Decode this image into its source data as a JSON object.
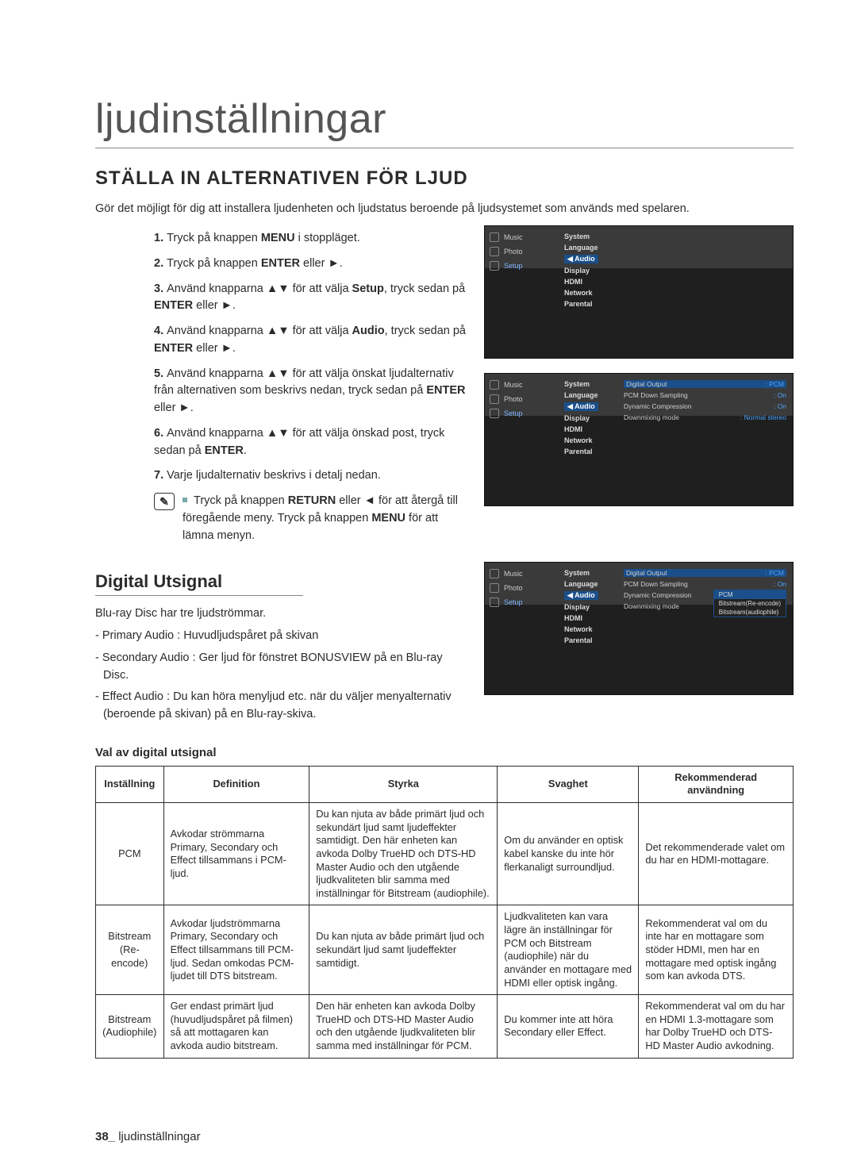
{
  "chapter": "ljudinställningar",
  "section": "STÄLLA IN ALTERNATIVEN FÖR LJUD",
  "intro": "Gör det möjligt för dig att installera ljudenheten och ljudstatus beroende på ljudsystemet som används med spelaren.",
  "steps": [
    {
      "n": "1.",
      "t": "Tryck på knappen <b>MENU</b> i stoppläget."
    },
    {
      "n": "2.",
      "t": "Tryck på knappen <b>ENTER</b> eller ►."
    },
    {
      "n": "3.",
      "t": "Använd knapparna ▲▼ för att välja <b>Setup</b>, tryck sedan på <b>ENTER</b> eller ►."
    },
    {
      "n": "4.",
      "t": "Använd knapparna ▲▼ för att välja <b>Audio</b>, tryck sedan på <b>ENTER</b> eller ►."
    },
    {
      "n": "5.",
      "t": "Använd knapparna ▲▼ för att välja önskat ljudalternativ från alternativen som beskrivs nedan, tryck sedan på <b>ENTER</b> eller ►."
    },
    {
      "n": "6.",
      "t": "Använd knapparna ▲▼ för att välja önskad post, tryck sedan på <b>ENTER</b>."
    },
    {
      "n": "7.",
      "t": "Varje ljudalternativ beskrivs i detalj nedan."
    }
  ],
  "note": "Tryck på knappen <b>RETURN</b> eller ◄ för att återgå till föregående meny. Tryck på knappen <b>MENU</b> för att lämna menyn.",
  "osd": {
    "side": [
      "Music",
      "Photo",
      "Setup"
    ],
    "menu": [
      "System",
      "Language",
      "Audio",
      "Display",
      "HDMI",
      "Network",
      "Parental"
    ],
    "rows": [
      {
        "k": "Digital Output",
        "v": "PCM"
      },
      {
        "k": "PCM Down Sampling",
        "v": "On"
      },
      {
        "k": "Dynamic Compression",
        "v": "On"
      },
      {
        "k": "Downmixing mode",
        "v": "Normal stereo"
      }
    ],
    "dropdown": [
      "PCM",
      "Bitstream(Re-encode)",
      "Bitstream(audiophile)"
    ]
  },
  "sub_heading": "Digital Utsignal",
  "bluray_intro": "Blu-ray Disc har tre ljudströmmar.",
  "bluray_list": [
    "- Primary Audio : Huvudljudspåret på skivan",
    "- Secondary Audio : Ger ljud för fönstret BONUSVIEW på en Blu-ray Disc.",
    "- Effect Audio : Du kan höra menyljud etc. när du väljer menyalternativ (beroende på skivan) på en Blu-ray-skiva."
  ],
  "table_title": "Val av digital utsignal",
  "table": {
    "headers": [
      "Inställning",
      "Definition",
      "Styrka",
      "Svaghet",
      "Rekommenderad användning"
    ],
    "rows": [
      {
        "setting": "PCM",
        "definition": "Avkodar strömmarna Primary, Secondary och Effect tillsammans i PCM-ljud.",
        "strength": "Du kan njuta av både primärt ljud och sekundärt ljud samt ljudeffekter samtidigt. Den här enheten kan avkoda Dolby TrueHD och DTS-HD Master Audio och den utgående ljudkvaliteten blir samma med inställningar för Bitstream (audiophile).",
        "weakness": "Om du använder en optisk kabel kanske du inte hör flerkanaligt surroundljud.",
        "rec": "Det rekommenderade valet om du har en HDMI-mottagare."
      },
      {
        "setting": "Bitstream (Re-encode)",
        "definition": "Avkodar ljudströmmarna Primary, Secondary och Effect tillsammans till PCM-ljud. Sedan omkodas PCM-ljudet till DTS bitstream.",
        "strength": "Du kan njuta av både primärt ljud och sekundärt ljud samt ljudeffekter samtidigt.",
        "weakness": "Ljudkvaliteten kan vara lägre än inställningar för PCM och Bitstream (audiophile) när du använder en mottagare med HDMI eller optisk ingång.",
        "rec": "Rekommenderat val om du inte har en mottagare som stöder HDMI, men har en mottagare med optisk ingång som kan avkoda DTS."
      },
      {
        "setting": "Bitstream (Audiophile)",
        "definition": "Ger endast primärt ljud (huvudljudspåret på filmen) så att mottagaren kan avkoda audio bitstream.",
        "strength": "Den här enheten kan avkoda Dolby TrueHD och DTS-HD Master Audio och den utgående ljudkvaliteten blir samma med inställningar för PCM.",
        "weakness": "Du kommer inte att höra Secondary eller Effect.",
        "rec": "Rekommenderat val om du har en HDMI 1.3-mottagare som har Dolby TrueHD och DTS-HD Master Audio avkodning."
      }
    ]
  },
  "footer": {
    "page": "38_",
    "label": "ljudinställningar"
  }
}
